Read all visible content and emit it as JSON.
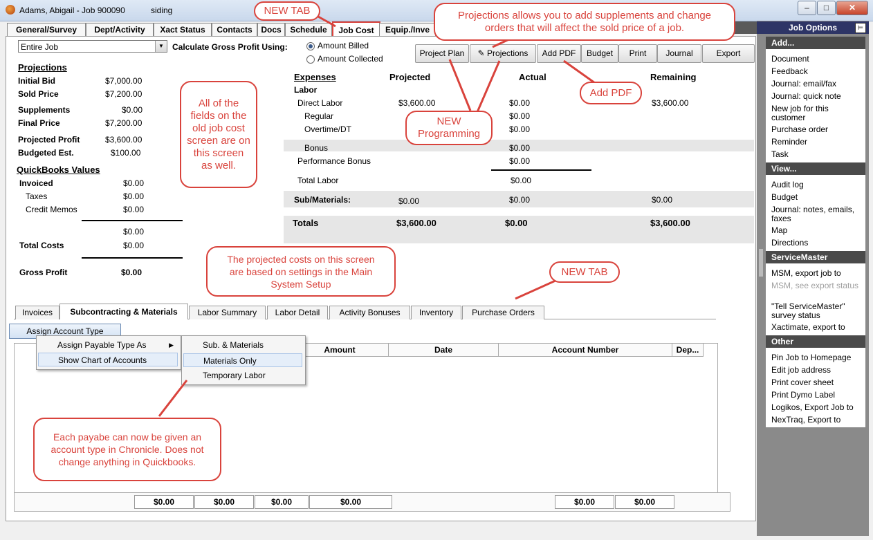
{
  "window": {
    "title": "Adams, Abigail - Job 900090",
    "subtitle": "siding"
  },
  "tabs": [
    "General/Survey",
    "Dept/Activity",
    "Xact Status",
    "Contacts",
    "Docs",
    "Schedule",
    "Job Cost",
    "Equip./Inve"
  ],
  "filter": {
    "select_value": "Entire Job",
    "calc_label": "Calculate Gross Profit Using:",
    "radio_billed": "Amount Billed",
    "radio_collected": "Amount Collected"
  },
  "toolbar": {
    "project_plan": "Project Plan",
    "projections": "Projections",
    "add_pdf": "Add PDF",
    "budget": "Budget",
    "print": "Print",
    "journal": "Journal",
    "export": "Export"
  },
  "projections": {
    "heading": "Projections",
    "rows": [
      {
        "label": "Initial Bid",
        "value": "$7,000.00"
      },
      {
        "label": "Sold Price",
        "value": "$7,200.00"
      },
      {
        "label": "Supplements",
        "value": "$0.00"
      },
      {
        "label": "Final Price",
        "value": "$7,200.00"
      },
      {
        "label": "Projected Profit",
        "value": "$3,600.00"
      },
      {
        "label": "Budgeted Est.",
        "value": "$100.00"
      }
    ]
  },
  "quickbooks": {
    "heading": "QuickBooks Values",
    "invoiced_label": "Invoiced",
    "invoiced": "$0.00",
    "taxes_label": "Taxes",
    "taxes": "$0.00",
    "credit_label": "Credit Memos",
    "credit": "$0.00",
    "subtotal": "$0.00",
    "total_costs_label": "Total Costs",
    "total_costs": "$0.00",
    "gross_label": "Gross Profit",
    "gross": "$0.00"
  },
  "expenses": {
    "heading": "Expenses",
    "col_projected": "Projected",
    "col_actual": "Actual",
    "col_remaining": "Remaining",
    "labor_label": "Labor",
    "direct_label": "Direct Labor",
    "direct_proj": "$3,600.00",
    "direct_act": "$0.00",
    "direct_rem": "$3,600.00",
    "regular_label": "Regular",
    "regular_act": "$0.00",
    "overtime_label": "Overtime/DT",
    "overtime_act": "$0.00",
    "bonus_label": "Bonus",
    "bonus_act": "$0.00",
    "perf_label": "Performance Bonus",
    "perf_act": "$0.00",
    "total_labor_label": "Total Labor",
    "total_labor_act": "$0.00",
    "sub_label": "Sub/Materials:",
    "sub_proj": "$0.00",
    "sub_act": "$0.00",
    "sub_rem": "$0.00",
    "totals_label": "Totals",
    "totals_proj": "$3,600.00",
    "totals_act": "$0.00",
    "totals_rem": "$3,600.00"
  },
  "bottom_tabs": [
    "Invoices",
    "Subcontracting & Materials",
    "Labor Summary",
    "Labor Detail",
    "Activity Bonuses",
    "Inventory",
    "Purchase Orders"
  ],
  "assign_button": "Assign Account Type",
  "grid_headers": {
    "amount": "Amount",
    "date": "Date",
    "account": "Account Number",
    "dep": "Dep..."
  },
  "context_menu": [
    "Assign Payable Type As",
    "Show Chart of Accounts"
  ],
  "submenu": [
    "Sub. & Materials",
    "Materials Only",
    "Temporary Labor"
  ],
  "footer_totals": [
    "$0.00",
    "$0.00",
    "$0.00",
    "$0.00",
    "$0.00",
    "$0.00"
  ],
  "sidebar": {
    "title": "Job Options",
    "sections": [
      {
        "title": "Add...",
        "items": [
          "Document",
          "Feedback",
          "Journal: email/fax",
          "Journal: quick note",
          "New job for this customer",
          "Purchase order",
          "Reminder",
          "Task"
        ]
      },
      {
        "title": "View...",
        "items": [
          "Audit log",
          "Budget",
          "Journal: notes, emails, faxes",
          "Map",
          "Directions"
        ]
      },
      {
        "title": "ServiceMaster",
        "items": [
          "MSM, export job to",
          "MSM, see export status",
          "\"Tell ServiceMaster\" survey status",
          "Xactimate, export to"
        ]
      },
      {
        "title": "Other",
        "items": [
          "Pin Job to Homepage",
          "Edit job address",
          "Print cover sheet",
          "Print Dymo Label",
          "Logikos, Export Job to",
          "NexTraq, Export to"
        ]
      }
    ]
  },
  "callouts": {
    "new_tab_top": "NEW TAB",
    "projections_note": "Projections allows you to add supplements and change orders that will affect the sold price of a job.",
    "fields_note": "All of the fields on the old job cost screen are on this screen as well.",
    "new_programming": "NEW Programming",
    "add_pdf_note": "Add PDF",
    "projected_costs_note": "The projected costs on this screen are based on settings in the Main System Setup",
    "new_tab_bottom": "NEW TAB",
    "payable_note": "Each payabe can now be given an account type in Chronicle. Does not change anything in Quickbooks."
  }
}
